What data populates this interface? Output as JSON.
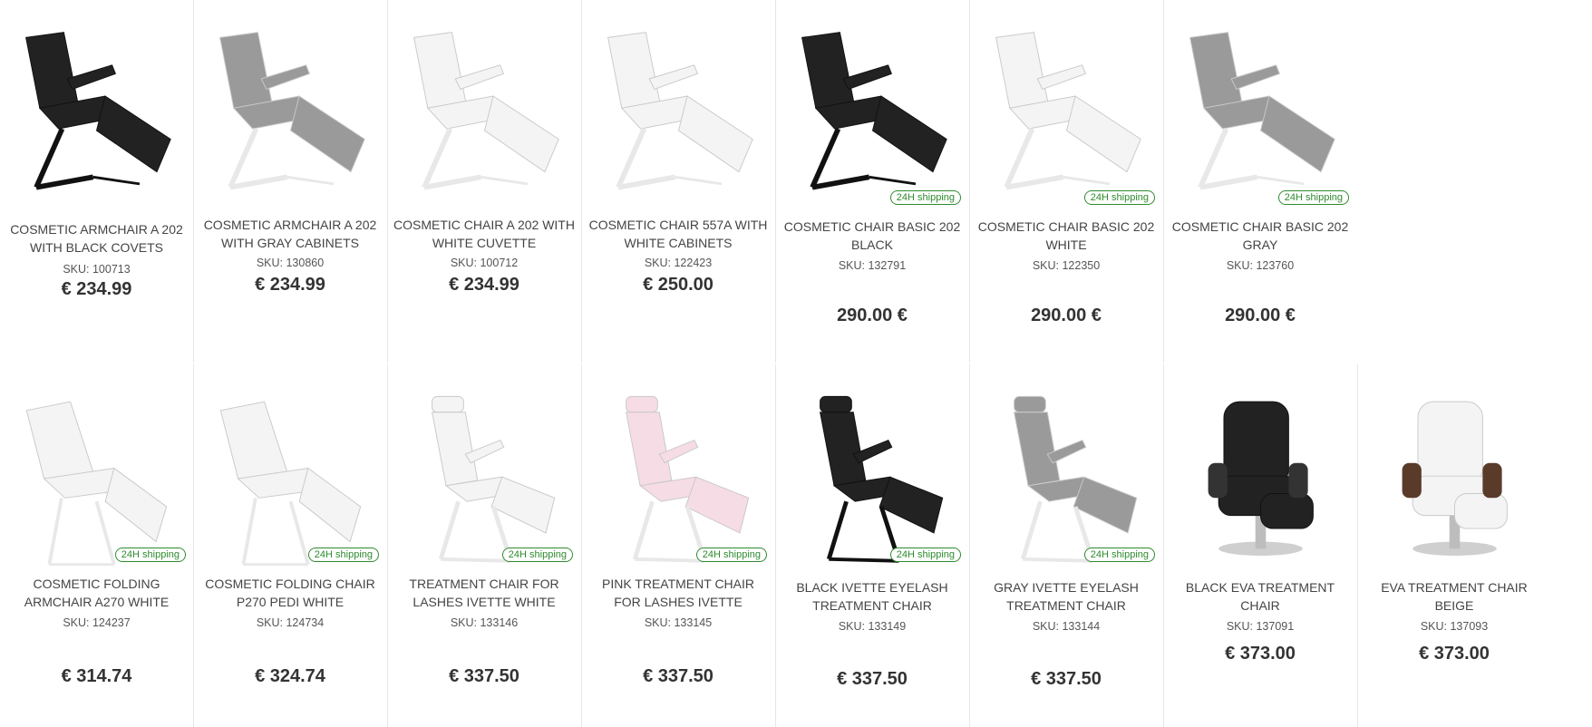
{
  "badge_text": "24H shipping",
  "colors": {
    "badge": "#2e8b2e",
    "black": "#222222",
    "gray": "#9a9a9a",
    "white": "#f4f4f4",
    "pink": "#f6dce4",
    "frame_dark": "#111111",
    "frame_light": "#e8e8e8"
  },
  "products": [
    {
      "name": "COSMETIC ARMCHAIR A 202 WITH BLACK COVETS",
      "sku": "SKU: 100713",
      "price": "€ 234.99",
      "color": "black",
      "badge": false
    },
    {
      "name": "COSMETIC ARMCHAIR A 202 WITH GRAY CABINETS",
      "sku": "SKU: 130860",
      "price": "€ 234.99",
      "color": "gray",
      "badge": false
    },
    {
      "name": "COSMETIC CHAIR A 202 WITH WHITE CUVETTE",
      "sku": "SKU: 100712",
      "price": "€ 234.99",
      "color": "white",
      "badge": false
    },
    {
      "name": "COSMETIC CHAIR 557A WITH WHITE CABINETS",
      "sku": "SKU: 122423",
      "price": "€ 250.00",
      "color": "white",
      "badge": false
    },
    {
      "name": "COSMETIC CHAIR BASIC 202 BLACK",
      "sku": "SKU: 132791",
      "price": "290.00 €",
      "color": "black",
      "badge": true
    },
    {
      "name": "COSMETIC CHAIR BASIC 202 WHITE",
      "sku": "SKU: 122350",
      "price": "290.00 €",
      "color": "white",
      "badge": true
    },
    {
      "name": "COSMETIC CHAIR BASIC 202 GRAY",
      "sku": "SKU: 123760",
      "price": "290.00 €",
      "color": "gray",
      "badge": true
    },
    {
      "name": "COSMETIC FOLDING ARMCHAIR A270 WHITE",
      "sku": "SKU: 124237",
      "price": "€ 314.74",
      "color": "white",
      "badge": true
    },
    {
      "name": "COSMETIC FOLDING CHAIR P270 PEDI WHITE",
      "sku": "SKU: 124734",
      "price": "€ 324.74",
      "color": "white",
      "badge": true
    },
    {
      "name": "TREATMENT CHAIR FOR LASHES IVETTE WHITE",
      "sku": "SKU: 133146",
      "price": "€ 337.50",
      "color": "white",
      "badge": true
    },
    {
      "name": "PINK TREATMENT CHAIR FOR LASHES IVETTE",
      "sku": "SKU: 133145",
      "price": "€ 337.50",
      "color": "pink",
      "badge": true
    },
    {
      "name": "BLACK IVETTE EYELASH TREATMENT CHAIR",
      "sku": "SKU: 133149",
      "price": "€ 337.50",
      "color": "black",
      "badge": true
    },
    {
      "name": "GRAY IVETTE EYELASH TREATMENT CHAIR",
      "sku": "SKU: 133144",
      "price": "€ 337.50",
      "color": "gray",
      "badge": true
    },
    {
      "name": "BLACK EVA TREATMENT CHAIR",
      "sku": "SKU: 137091",
      "price": "€ 373.00",
      "color": "black",
      "badge": false
    },
    {
      "name": "EVA TREATMENT CHAIR BEIGE",
      "sku": "SKU: 137093",
      "price": "€ 373.00",
      "color": "white",
      "badge": false
    }
  ]
}
